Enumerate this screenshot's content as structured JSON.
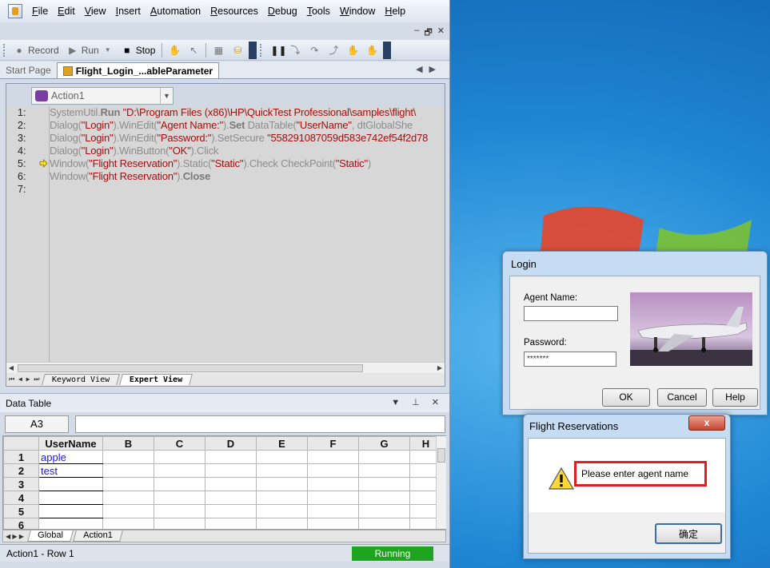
{
  "menu": {
    "items": [
      {
        "pre": "",
        "u": "F",
        "post": "ile"
      },
      {
        "pre": "",
        "u": "E",
        "post": "dit"
      },
      {
        "pre": "",
        "u": "V",
        "post": "iew"
      },
      {
        "pre": "",
        "u": "I",
        "post": "nsert"
      },
      {
        "pre": "",
        "u": "A",
        "post": "utomation"
      },
      {
        "pre": "",
        "u": "R",
        "post": "esources"
      },
      {
        "pre": "",
        "u": "D",
        "post": "ebug"
      },
      {
        "pre": "",
        "u": "T",
        "post": "ools"
      },
      {
        "pre": "",
        "u": "W",
        "post": "indow"
      },
      {
        "pre": "",
        "u": "H",
        "post": "elp"
      }
    ]
  },
  "toolbar": {
    "record": "Record",
    "run": "Run",
    "stop": "Stop"
  },
  "tabs": {
    "start": "Start Page",
    "active": "Flight_Login_...ableParameter"
  },
  "editor": {
    "action": "Action1",
    "line_numbers": [
      "1:",
      "2:",
      "3:",
      "4:",
      "5:",
      "6:",
      "7:"
    ],
    "lines": [
      [
        [
          "",
          "SystemUtil."
        ],
        [
          "b",
          "Run "
        ],
        [
          "s",
          "\"D:\\Program Files (x86)\\HP\\QuickTest Professional\\samples\\flight\\"
        ]
      ],
      [
        [
          "",
          "Dialog("
        ],
        [
          "s",
          "\"Login\""
        ],
        [
          "",
          ").WinEdit("
        ],
        [
          "s",
          "\"Agent Name:\""
        ],
        [
          "",
          ")."
        ],
        [
          "b",
          "Set "
        ],
        [
          "",
          "DataTable("
        ],
        [
          "s",
          "\"UserName\""
        ],
        [
          "",
          ", dtGlobalShe"
        ]
      ],
      [
        [
          "",
          "Dialog("
        ],
        [
          "s",
          "\"Login\""
        ],
        [
          "",
          ").WinEdit("
        ],
        [
          "s",
          "\"Password:\""
        ],
        [
          "",
          ").SetSecure "
        ],
        [
          "s",
          "\"558291087059d583e742ef54f2d78"
        ]
      ],
      [
        [
          "",
          "Dialog("
        ],
        [
          "s",
          "\"Login\""
        ],
        [
          "",
          ").WinButton("
        ],
        [
          "s",
          "\"OK\""
        ],
        [
          "",
          ").Click"
        ]
      ],
      [
        [
          "",
          "Window("
        ],
        [
          "s",
          "\"Flight Reservation\""
        ],
        [
          "",
          ").Static("
        ],
        [
          "s",
          "\"Static\""
        ],
        [
          "",
          ").Check CheckPoint("
        ],
        [
          "s",
          "\"Static\""
        ],
        [
          "",
          ")"
        ]
      ],
      [
        [
          "",
          "Window("
        ],
        [
          "s",
          "\"Flight Reservation\""
        ],
        [
          "",
          ")."
        ],
        [
          "b",
          "Close"
        ]
      ],
      []
    ],
    "current_line": 5,
    "view_tabs": {
      "keyword": "Keyword View",
      "expert": "Expert View"
    }
  },
  "data_table": {
    "title": "Data Table",
    "cell_ref": "A3",
    "columns": [
      "UserName",
      "B",
      "C",
      "D",
      "E",
      "F",
      "G",
      "H"
    ],
    "rows": [
      {
        "n": "1",
        "v": "apple"
      },
      {
        "n": "2",
        "v": "test"
      },
      {
        "n": "3",
        "v": ""
      },
      {
        "n": "4",
        "v": ""
      },
      {
        "n": "5",
        "v": ""
      },
      {
        "n": "6",
        "v": ""
      }
    ],
    "sheets": {
      "global": "Global",
      "action": "Action1"
    }
  },
  "status": {
    "text": "Action1  - Row  1",
    "state": "Running"
  },
  "login_dialog": {
    "title": "Login",
    "agent_label": "Agent Name:",
    "agent_value": "",
    "password_label": "Password:",
    "password_value": "*******",
    "ok": "OK",
    "cancel": "Cancel",
    "help": "Help"
  },
  "msgbox": {
    "title": "Flight Reservations",
    "close": "x",
    "message": "Please enter agent name",
    "ok": "确定"
  }
}
